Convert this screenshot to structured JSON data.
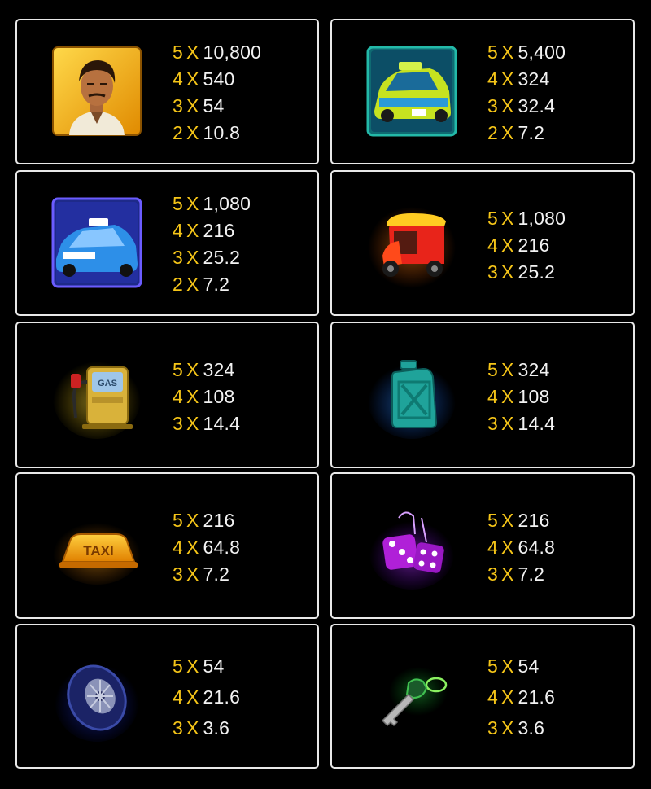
{
  "colors": {
    "count": "#f5c518",
    "value": "#f2f2f2",
    "border": "#e8e8e8",
    "background": "#000000"
  },
  "multiplier_sign": "X",
  "symbols": [
    {
      "icon": "driver-portrait-icon",
      "pays": [
        {
          "count": "5",
          "value": "10,800"
        },
        {
          "count": "4",
          "value": "540"
        },
        {
          "count": "3",
          "value": "54"
        },
        {
          "count": "2",
          "value": "10.8"
        }
      ]
    },
    {
      "icon": "yellow-green-taxi-icon",
      "pays": [
        {
          "count": "5",
          "value": "5,400"
        },
        {
          "count": "4",
          "value": "324"
        },
        {
          "count": "3",
          "value": "32.4"
        },
        {
          "count": "2",
          "value": "7.2"
        }
      ]
    },
    {
      "icon": "blue-taxi-car-icon",
      "pays": [
        {
          "count": "5",
          "value": "1,080"
        },
        {
          "count": "4",
          "value": "216"
        },
        {
          "count": "3",
          "value": "25.2"
        },
        {
          "count": "2",
          "value": "7.2"
        }
      ]
    },
    {
      "icon": "auto-rickshaw-icon",
      "pays": [
        {
          "count": "5",
          "value": "1,080"
        },
        {
          "count": "4",
          "value": "216"
        },
        {
          "count": "3",
          "value": "25.2"
        }
      ]
    },
    {
      "icon": "gas-pump-icon",
      "pays": [
        {
          "count": "5",
          "value": "324"
        },
        {
          "count": "4",
          "value": "108"
        },
        {
          "count": "3",
          "value": "14.4"
        }
      ]
    },
    {
      "icon": "jerry-can-icon",
      "pays": [
        {
          "count": "5",
          "value": "324"
        },
        {
          "count": "4",
          "value": "108"
        },
        {
          "count": "3",
          "value": "14.4"
        }
      ]
    },
    {
      "icon": "taxi-roof-sign-icon",
      "sign_text": "TAXI",
      "pays": [
        {
          "count": "5",
          "value": "216"
        },
        {
          "count": "4",
          "value": "64.8"
        },
        {
          "count": "3",
          "value": "7.2"
        }
      ]
    },
    {
      "icon": "fuzzy-dice-icon",
      "pays": [
        {
          "count": "5",
          "value": "216"
        },
        {
          "count": "4",
          "value": "64.8"
        },
        {
          "count": "3",
          "value": "7.2"
        }
      ]
    },
    {
      "icon": "tire-icon",
      "pays": [
        {
          "count": "5",
          "value": "54"
        },
        {
          "count": "4",
          "value": "21.6"
        },
        {
          "count": "3",
          "value": "3.6"
        }
      ]
    },
    {
      "icon": "car-key-icon",
      "pays": [
        {
          "count": "5",
          "value": "54"
        },
        {
          "count": "4",
          "value": "21.6"
        },
        {
          "count": "3",
          "value": "3.6"
        }
      ]
    }
  ]
}
